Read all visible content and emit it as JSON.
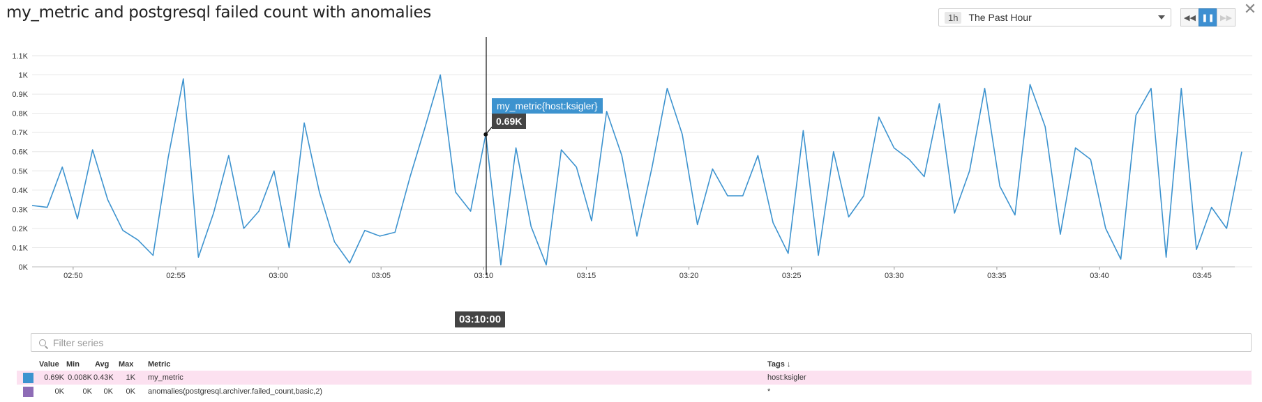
{
  "header": {
    "title": "my_metric and postgresql failed count with anomalies",
    "close_icon": "close-icon"
  },
  "timeframe": {
    "abbr": "1h",
    "label": "The Past Hour"
  },
  "controls": {
    "rewind_icon": "rewind-icon",
    "pause_icon": "pause-icon",
    "forward_icon": "fast-forward-icon",
    "paused": true
  },
  "colors": {
    "series": "#3d93cf",
    "anomaly": "#8e6cb6",
    "highlight_row": "#fce1f0",
    "tooltip_name": "#3d93cf",
    "tooltip_value": "#444444"
  },
  "chart_data": {
    "type": "line",
    "ylim": [
      0,
      1.1
    ],
    "y_ticks": [
      "0K",
      "0.1K",
      "0.2K",
      "0.3K",
      "0.4K",
      "0.5K",
      "0.6K",
      "0.7K",
      "0.8K",
      "0.9K",
      "1K",
      "1.1K"
    ],
    "x_ticks": [
      "02:50",
      "02:55",
      "03:00",
      "03:05",
      "03:10",
      "03:15",
      "03:20",
      "03:25",
      "03:30",
      "03:35",
      "03:40",
      "03:45"
    ],
    "x_start_minute": 48,
    "x_end_minute": 107,
    "series": [
      {
        "name": "my_metric{host:ksigler}",
        "values": [
          0.32,
          0.31,
          0.52,
          0.25,
          0.61,
          0.35,
          0.19,
          0.14,
          0.06,
          0.57,
          0.98,
          0.05,
          0.28,
          0.58,
          0.2,
          0.29,
          0.5,
          0.1,
          0.75,
          0.39,
          0.13,
          0.02,
          0.19,
          0.16,
          0.18,
          0.47,
          0.73,
          1.0,
          0.39,
          0.29,
          0.69,
          0.01,
          0.62,
          0.21,
          0.01,
          0.61,
          0.52,
          0.24,
          0.81,
          0.58,
          0.16,
          0.52,
          0.93,
          0.69,
          0.22,
          0.51,
          0.37,
          0.37,
          0.58,
          0.23,
          0.07,
          0.71,
          0.06,
          0.6,
          0.26,
          0.37,
          0.78,
          0.62,
          0.56,
          0.47,
          0.85,
          0.28,
          0.5,
          0.93,
          0.42,
          0.27,
          0.95,
          0.73,
          0.17,
          0.62,
          0.56,
          0.2,
          0.04,
          0.79,
          0.93,
          0.05,
          0.93,
          0.09,
          0.31,
          0.2,
          0.6
        ]
      },
      {
        "name": "anomalies(postgresql.archiver.failed_count,basic,2)",
        "values": []
      }
    ]
  },
  "tooltip": {
    "name": "my_metric{host:ksigler}",
    "value": "0.69K",
    "time": "03:10:00",
    "index": 30
  },
  "filter": {
    "placeholder": "Filter series"
  },
  "legend": {
    "headers": {
      "value": "Value",
      "min": "Min",
      "avg": "Avg",
      "max": "Max",
      "metric": "Metric",
      "tags": "Tags ↓"
    },
    "rows": [
      {
        "color": "#3d93cf",
        "value": "0.69K",
        "min": "0.008K",
        "avg": "0.43K",
        "max": "1K",
        "metric": "my_metric",
        "tags": "host:ksigler"
      },
      {
        "color": "#8e6cb6",
        "value": "0K",
        "min": "0K",
        "avg": "0K",
        "max": "0K",
        "metric": "anomalies(postgresql.archiver.failed_count,basic,2)",
        "tags": "*"
      }
    ]
  }
}
